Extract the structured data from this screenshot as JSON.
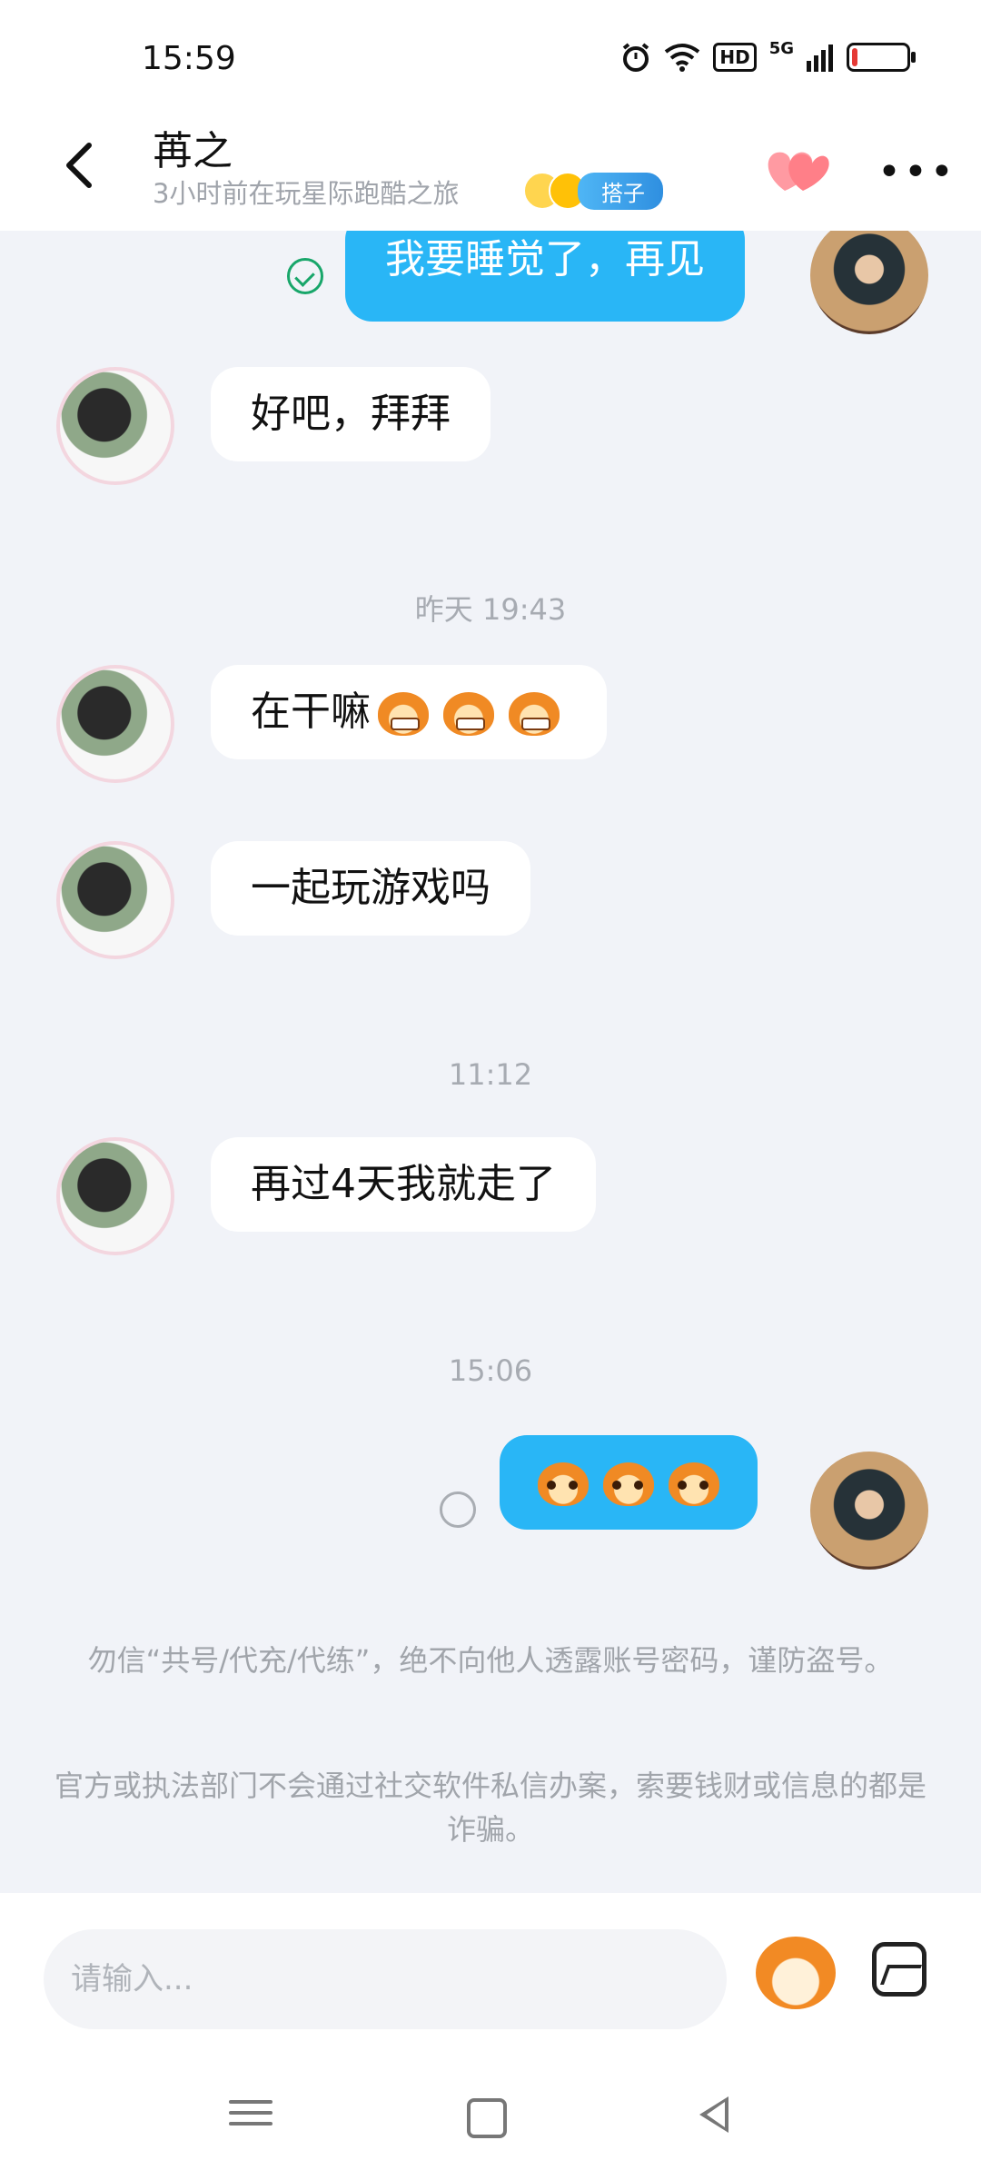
{
  "status_bar": {
    "time": "15:59",
    "hd": "HD",
    "network": "5G"
  },
  "header": {
    "name": "苒之",
    "status": "3小时前在玩星际跑酷之旅",
    "tag": "搭子"
  },
  "messages": {
    "m1": "我要睡觉了，再见",
    "m2": "好吧，拜拜",
    "ts1": "昨天 19:43",
    "m3": "在干嘛",
    "m4": "一起玩游戏吗",
    "ts2": "11:12",
    "m5": "再过4天我就走了",
    "ts3": "15:06"
  },
  "notices": {
    "n1": "勿信“共号/代充/代练”，绝不向他人透露账号密码，谨防盗号。",
    "n2": "官方或执法部门不会通过社交软件私信办案，索要钱财或信息的都是诈骗。"
  },
  "input": {
    "placeholder": "请输入..."
  },
  "colors": {
    "bubble_out": "#29b6f6",
    "bubble_in": "#ffffff",
    "background": "#f1f3f8",
    "tag": "#2f8fe0"
  },
  "icons": [
    "back-arrow-icon",
    "hearts-icon",
    "more-icon",
    "sticker-icon",
    "image-icon",
    "menu-nav-icon",
    "home-nav-icon",
    "back-nav-icon"
  ]
}
